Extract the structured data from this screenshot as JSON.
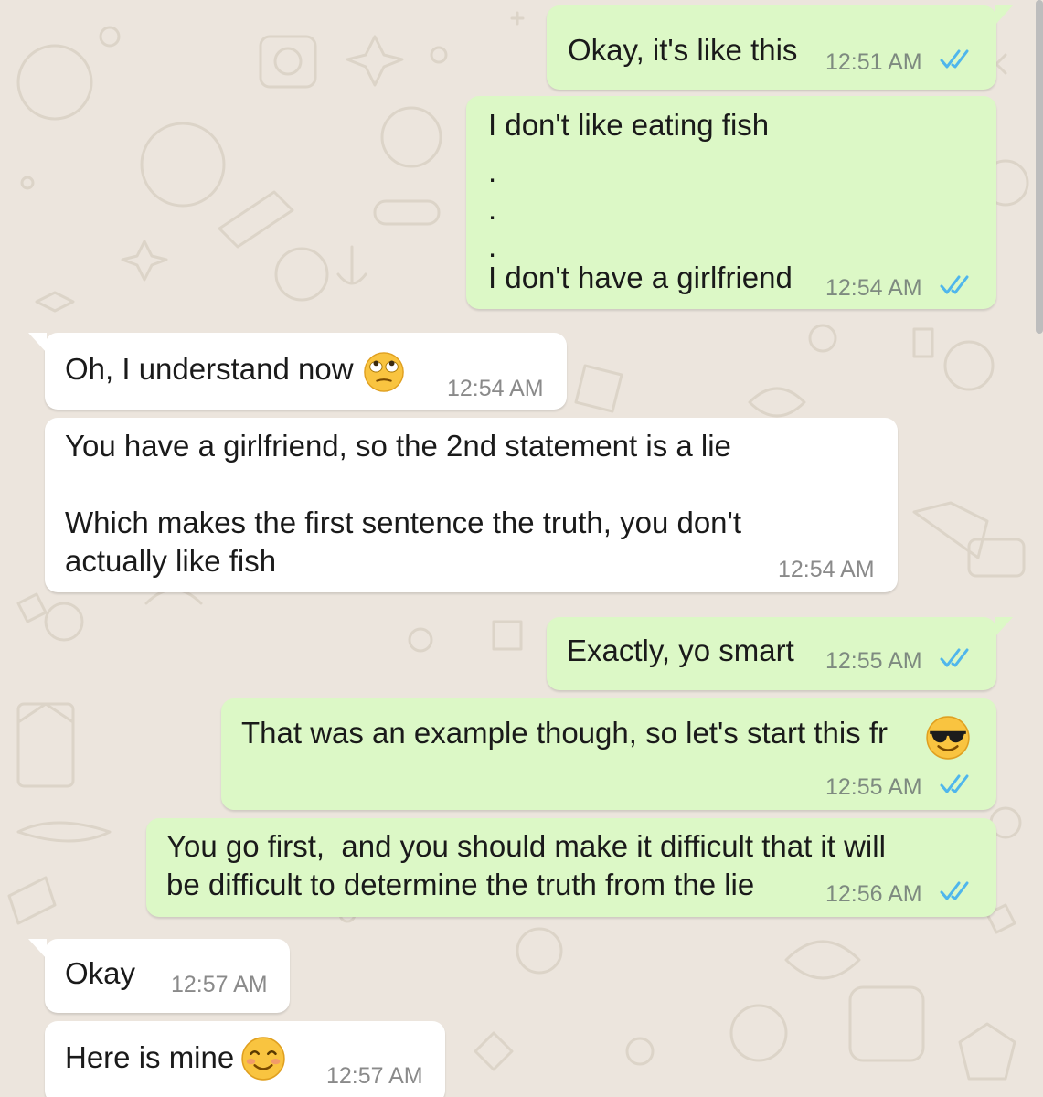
{
  "colors": {
    "outgoing_bubble": "#dcf8c6",
    "incoming_bubble": "#ffffff",
    "background": "#ece5dd",
    "read_ticks": "#4fb6ec"
  },
  "messages": [
    {
      "direction": "outgoing",
      "lines": [
        "Okay, it's like this"
      ],
      "time": "12:51 AM",
      "status": "read"
    },
    {
      "direction": "outgoing",
      "lines": [
        "I don't like eating fish",
        ".",
        ".",
        ".",
        "I don't have a girlfriend"
      ],
      "time": "12:54 AM",
      "status": "read"
    },
    {
      "direction": "incoming",
      "lines": [
        "Oh, I understand now"
      ],
      "emoji": "face-with-rolling-eyes",
      "time": "12:54 AM"
    },
    {
      "direction": "incoming",
      "lines": [
        "You have a girlfriend, so the 2nd statement is a lie",
        "",
        "Which makes the first sentence the truth, you don't",
        "actually like fish"
      ],
      "time": "12:54 AM"
    },
    {
      "direction": "outgoing",
      "lines": [
        "Exactly, yo smart"
      ],
      "time": "12:55 AM",
      "status": "read"
    },
    {
      "direction": "outgoing",
      "lines": [
        "That was an example though, so let's start this fr"
      ],
      "emoji": "smiling-face-with-sunglasses",
      "time": "12:55 AM",
      "status": "read"
    },
    {
      "direction": "outgoing",
      "lines": [
        "You go first,  and you should make it difficult that it will",
        "be difficult to determine the truth from the lie"
      ],
      "time": "12:56 AM",
      "status": "read"
    },
    {
      "direction": "incoming",
      "lines": [
        "Okay"
      ],
      "time": "12:57 AM"
    },
    {
      "direction": "incoming",
      "lines": [
        "Here is mine"
      ],
      "emoji": "smiling-face-with-smiling-eyes",
      "time": "12:57 AM"
    }
  ]
}
